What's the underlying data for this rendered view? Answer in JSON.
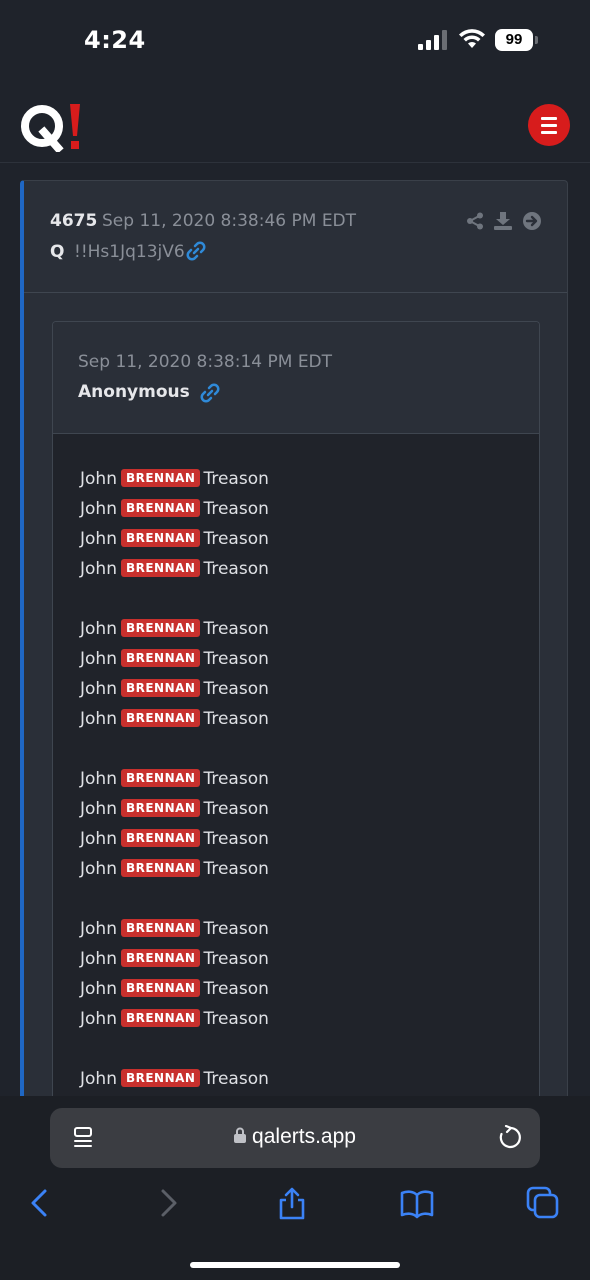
{
  "status_bar": {
    "time": "4:24",
    "battery": "99"
  },
  "header": {
    "logo_text": "Q!",
    "menu_icon": "hamburger-icon",
    "accent": "#d71c1c"
  },
  "post": {
    "number": "4675",
    "date": "Sep 11, 2020 8:38:46 PM EDT",
    "poster": "Q",
    "tripcode": "!!Hs1Jq13jV6",
    "tools": [
      "share-icon",
      "download-icon",
      "arrow-right-icon"
    ],
    "accent": "#1f67c4"
  },
  "quote": {
    "date": "Sep 11, 2020 8:38:14 PM EDT",
    "name": "Anonymous",
    "lines": [
      {
        "pre": "John",
        "tag": "BRENNAN",
        "post": "Treason"
      },
      {
        "pre": "John",
        "tag": "BRENNAN",
        "post": "Treason"
      },
      {
        "pre": "John",
        "tag": "BRENNAN",
        "post": "Treason"
      },
      {
        "pre": "John",
        "tag": "BRENNAN",
        "post": "Treason"
      },
      {
        "pre": "John",
        "tag": "BRENNAN",
        "post": "Treason"
      },
      {
        "pre": "John",
        "tag": "BRENNAN",
        "post": "Treason"
      },
      {
        "pre": "John",
        "tag": "BRENNAN",
        "post": "Treason"
      },
      {
        "pre": "John",
        "tag": "BRENNAN",
        "post": "Treason"
      },
      {
        "pre": "John",
        "tag": "BRENNAN",
        "post": "Treason"
      },
      {
        "pre": "John",
        "tag": "BRENNAN",
        "post": "Treason"
      },
      {
        "pre": "John",
        "tag": "BRENNAN",
        "post": "Treason"
      },
      {
        "pre": "John",
        "tag": "BRENNAN",
        "post": "Treason"
      },
      {
        "pre": "John",
        "tag": "BRENNAN",
        "post": "Treason"
      },
      {
        "pre": "John",
        "tag": "BRENNAN",
        "post": "Treason"
      },
      {
        "pre": "John",
        "tag": "BRENNAN",
        "post": "Treason"
      },
      {
        "pre": "John",
        "tag": "BRENNAN",
        "post": "Treason"
      },
      {
        "pre": "John",
        "tag": "BRENNAN",
        "post": "Treason"
      }
    ],
    "tag_color": "#c8302d"
  },
  "browser": {
    "url": "qalerts.app",
    "nav": [
      "back-icon",
      "forward-icon",
      "share-icon",
      "bookmarks-icon",
      "tabs-icon"
    ],
    "accent": "#3b82f6"
  }
}
